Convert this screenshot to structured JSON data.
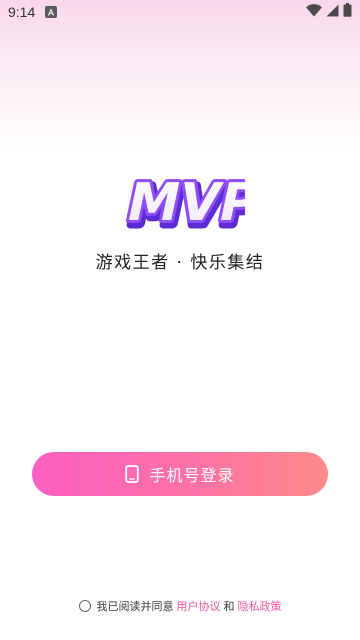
{
  "status_bar": {
    "time": "9:14",
    "notification_icon": "font-a-icon",
    "wifi_icon": "wifi-icon",
    "signal_icon": "cellular-signal-icon",
    "battery_icon": "battery-icon"
  },
  "logo": {
    "text": "MVP"
  },
  "slogan": "游戏王者 · 快乐集结",
  "login_button": {
    "label": "手机号登录",
    "icon": "smartphone-icon"
  },
  "agreement": {
    "prefix": "我已阅读并同意",
    "user_agreement": "用户协议",
    "and": "和",
    "privacy_policy": "隐私政策"
  },
  "colors": {
    "accent_link": "#f0549c",
    "button_gradient_start": "#fb5ec2",
    "button_gradient_end": "#fd8a8a",
    "logo_purple": "#7b3cf2"
  }
}
